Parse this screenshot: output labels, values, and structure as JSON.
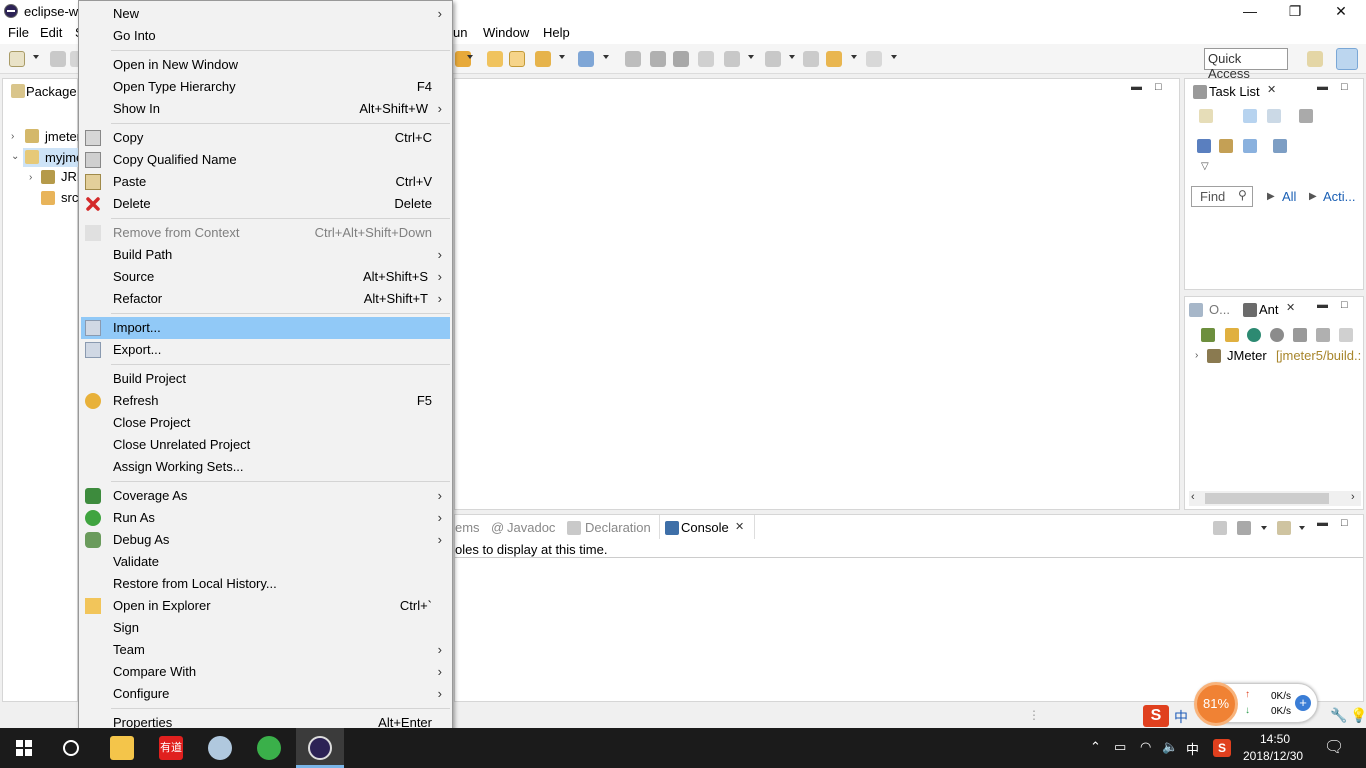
{
  "window": {
    "title": "eclipse-w",
    "controls": [
      "—",
      "❐",
      "✕"
    ]
  },
  "menubar": {
    "items": [
      "File",
      "Edit",
      "S",
      "un",
      "Window",
      "Help"
    ]
  },
  "toolbar": {
    "quick_access": "Quick Access"
  },
  "package_explorer": {
    "tab_label": "Package",
    "tree": [
      {
        "label": "jmeter",
        "icon": "project-icon"
      },
      {
        "label": "myjme",
        "icon": "project-open-icon"
      },
      {
        "label": "JRE",
        "icon": "library-icon"
      },
      {
        "label": "src",
        "icon": "package-folder-icon"
      }
    ]
  },
  "task_list": {
    "tab_label": "Task List",
    "find_placeholder": "Find",
    "filter_all": "All",
    "filter_acti": "Acti..."
  },
  "ant_view": {
    "tab_outline": "O...",
    "tab_ant": "Ant",
    "tree_item": "JMeter",
    "tree_item_path": "[jmeter5/build.:"
  },
  "console_area": {
    "tabs": [
      "ems",
      "Javadoc",
      "Declaration",
      "Console"
    ],
    "message": "oles to display at this time."
  },
  "context_menu": {
    "items": [
      {
        "label": "New",
        "shortcut": "",
        "submenu": true,
        "icon": ""
      },
      {
        "label": "Go Into",
        "shortcut": "",
        "submenu": false,
        "icon": ""
      },
      {
        "label": "Open in New Window",
        "shortcut": "",
        "submenu": false,
        "icon": ""
      },
      {
        "label": "Open Type Hierarchy",
        "shortcut": "F4",
        "submenu": false,
        "icon": ""
      },
      {
        "label": "Show In",
        "shortcut": "Alt+Shift+W",
        "submenu": true,
        "icon": ""
      },
      {
        "label": "Copy",
        "shortcut": "Ctrl+C",
        "submenu": false,
        "icon": "copy-icon"
      },
      {
        "label": "Copy Qualified Name",
        "shortcut": "",
        "submenu": false,
        "icon": "copy-qualified-icon"
      },
      {
        "label": "Paste",
        "shortcut": "Ctrl+V",
        "submenu": false,
        "icon": "paste-icon"
      },
      {
        "label": "Delete",
        "shortcut": "Delete",
        "submenu": false,
        "icon": "delete-icon"
      },
      {
        "label": "Remove from Context",
        "shortcut": "Ctrl+Alt+Shift+Down",
        "submenu": false,
        "icon": "remove-context-icon",
        "disabled": true
      },
      {
        "label": "Build Path",
        "shortcut": "",
        "submenu": true,
        "icon": ""
      },
      {
        "label": "Source",
        "shortcut": "Alt+Shift+S",
        "submenu": true,
        "icon": ""
      },
      {
        "label": "Refactor",
        "shortcut": "Alt+Shift+T",
        "submenu": true,
        "icon": ""
      },
      {
        "label": "Import...",
        "shortcut": "",
        "submenu": false,
        "icon": "import-icon",
        "highlighted": true
      },
      {
        "label": "Export...",
        "shortcut": "",
        "submenu": false,
        "icon": "export-icon"
      },
      {
        "label": "Build Project",
        "shortcut": "",
        "submenu": false,
        "icon": ""
      },
      {
        "label": "Refresh",
        "shortcut": "F5",
        "submenu": false,
        "icon": "refresh-icon"
      },
      {
        "label": "Close Project",
        "shortcut": "",
        "submenu": false,
        "icon": ""
      },
      {
        "label": "Close Unrelated Project",
        "shortcut": "",
        "submenu": false,
        "icon": ""
      },
      {
        "label": "Assign Working Sets...",
        "shortcut": "",
        "submenu": false,
        "icon": ""
      },
      {
        "label": "Coverage As",
        "shortcut": "",
        "submenu": true,
        "icon": "coverage-icon"
      },
      {
        "label": "Run As",
        "shortcut": "",
        "submenu": true,
        "icon": "run-icon"
      },
      {
        "label": "Debug As",
        "shortcut": "",
        "submenu": true,
        "icon": "debug-icon"
      },
      {
        "label": "Validate",
        "shortcut": "",
        "submenu": false,
        "icon": ""
      },
      {
        "label": "Restore from Local History...",
        "shortcut": "",
        "submenu": false,
        "icon": ""
      },
      {
        "label": "Open in Explorer",
        "shortcut": "Ctrl+`",
        "submenu": false,
        "icon": "folder-open-icon"
      },
      {
        "label": "Sign",
        "shortcut": "",
        "submenu": false,
        "icon": ""
      },
      {
        "label": "Team",
        "shortcut": "",
        "submenu": true,
        "icon": ""
      },
      {
        "label": "Compare With",
        "shortcut": "",
        "submenu": true,
        "icon": ""
      },
      {
        "label": "Configure",
        "shortcut": "",
        "submenu": true,
        "icon": ""
      },
      {
        "label": "Properties",
        "shortcut": "Alt+Enter",
        "submenu": false,
        "icon": ""
      }
    ]
  },
  "speed_widget": {
    "percent": "81%",
    "up": "0K/s",
    "down": "0K/s"
  },
  "taskbar": {
    "time": "14:50",
    "date": "2018/12/30",
    "ime": "中",
    "youdao_label": "有道"
  },
  "colors": {
    "highlight": "#91c9f7",
    "taskbar": "#1b1b1b",
    "widget_orange": "#f08234"
  }
}
